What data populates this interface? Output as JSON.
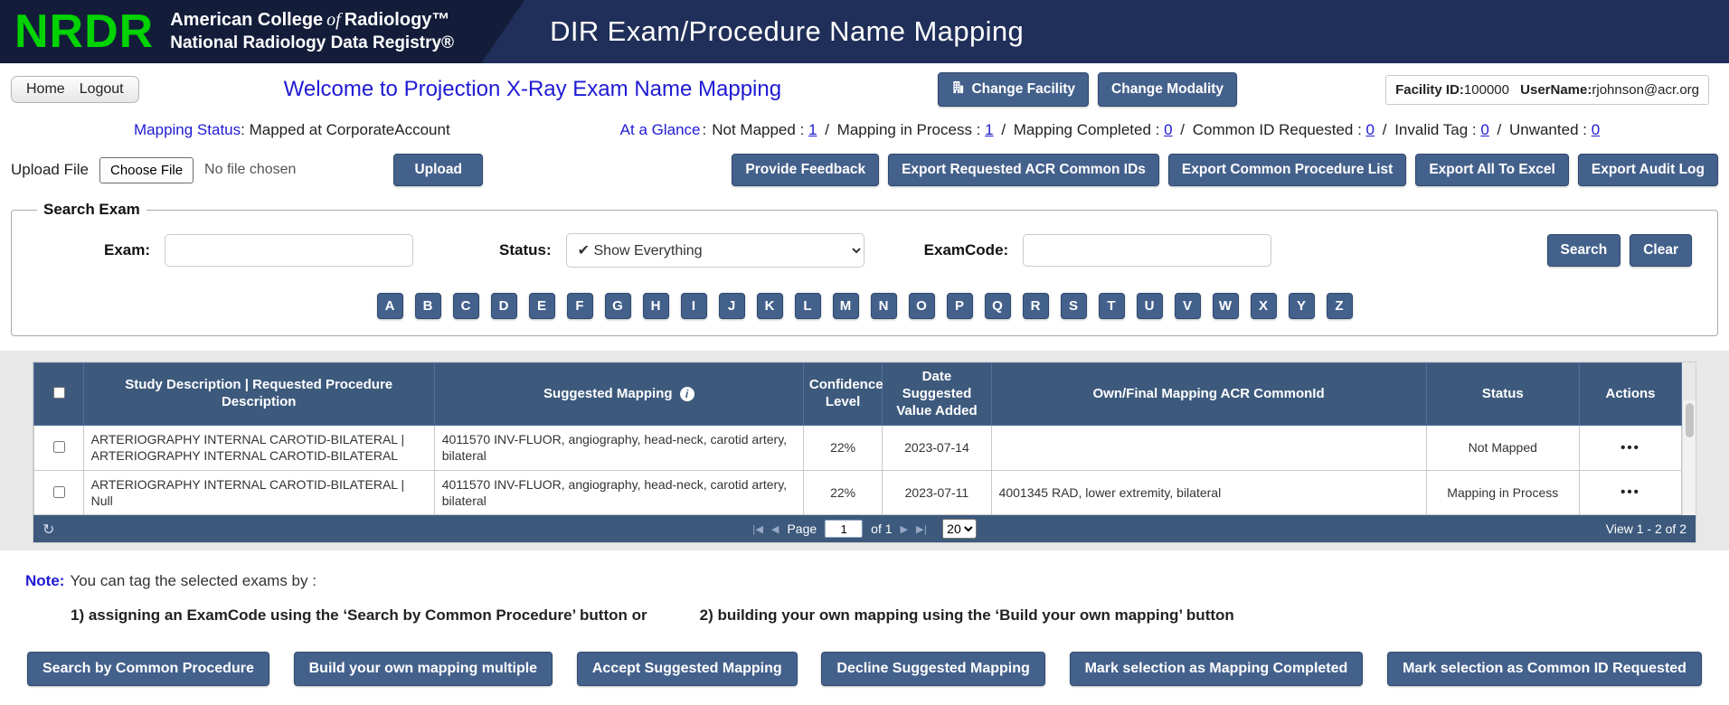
{
  "header": {
    "logo": "NRDR",
    "org_line1_pre": "American College",
    "org_line1_of": "of",
    "org_line1_post": "Radiology™",
    "org_line2": "National Radiology Data Registry®",
    "title": "DIR Exam/Procedure Name Mapping"
  },
  "topbar": {
    "home": "Home",
    "logout": "Logout",
    "welcome": "Welcome to Projection X-Ray Exam Name Mapping",
    "change_facility": "Change Facility",
    "change_modality": "Change Modality",
    "facility_id_label": "Facility ID:",
    "facility_id": "100000",
    "username_label": "UserName:",
    "username": "rjohnson@acr.org"
  },
  "status_row": {
    "mapping_status_label": "Mapping Status",
    "mapping_status_value": ": Mapped at CorporateAccount",
    "at_a_glance_label": "At a Glance",
    "at_a_glance_colon": ":",
    "separator": "/",
    "glance_items": [
      {
        "label": "Not Mapped",
        "count": "1"
      },
      {
        "label": "Mapping in Process",
        "count": "1"
      },
      {
        "label": "Mapping Completed",
        "count": "0"
      },
      {
        "label": "Common ID Requested",
        "count": "0"
      },
      {
        "label": "Invalid Tag",
        "count": "0"
      },
      {
        "label": "Unwanted",
        "count": "0"
      }
    ]
  },
  "upload_row": {
    "upload_file_label": "Upload File",
    "choose_file_label": "Choose File",
    "no_file_text": "No file chosen",
    "upload_button": "Upload",
    "export_buttons": [
      "Provide Feedback",
      "Export Requested ACR Common IDs",
      "Export Common Procedure List",
      "Export All To Excel",
      "Export Audit Log"
    ]
  },
  "search": {
    "legend": "Search Exam",
    "exam_label": "Exam:",
    "status_label": "Status:",
    "status_value": "✔ Show Everything",
    "examcode_label": "ExamCode:",
    "search_button": "Search",
    "clear_button": "Clear",
    "alphabet": [
      "A",
      "B",
      "C",
      "D",
      "E",
      "F",
      "G",
      "H",
      "I",
      "J",
      "K",
      "L",
      "M",
      "N",
      "O",
      "P",
      "Q",
      "R",
      "S",
      "T",
      "U",
      "V",
      "W",
      "X",
      "Y",
      "Z"
    ]
  },
  "table": {
    "columns": [
      {
        "key": "study_description",
        "label": "Study Description | Requested Procedure Description"
      },
      {
        "key": "suggested_mapping",
        "label": "Suggested Mapping",
        "info_icon": true
      },
      {
        "key": "confidence",
        "label": "Confidence Level"
      },
      {
        "key": "date_suggested",
        "label": "Date Suggested Value Added"
      },
      {
        "key": "own_final_mapping",
        "label": "Own/Final Mapping ACR CommonId"
      },
      {
        "key": "status",
        "label": "Status"
      },
      {
        "key": "actions",
        "label": "Actions"
      }
    ],
    "rows": [
      {
        "study_description": "ARTERIOGRAPHY INTERNAL CAROTID-BILATERAL | ARTERIOGRAPHY INTERNAL CAROTID-BILATERAL",
        "suggested_mapping": "4011570 INV-FLUOR, angiography, head-neck, carotid artery, bilateral",
        "confidence": "22%",
        "date_suggested": "2023-07-14",
        "own_final_mapping": "",
        "status": "Not Mapped",
        "actions": "•••"
      },
      {
        "study_description": "ARTERIOGRAPHY INTERNAL CAROTID-BILATERAL | Null",
        "suggested_mapping": "4011570 INV-FLUOR, angiography, head-neck, carotid artery, bilateral",
        "confidence": "22%",
        "date_suggested": "2023-07-11",
        "own_final_mapping": "4001345 RAD, lower extremity, bilateral",
        "status": "Mapping in Process",
        "actions": "•••"
      }
    ]
  },
  "pager": {
    "refresh_icon": "↻",
    "first_icon": "|◀",
    "prev_icon": "◀",
    "page_label": "Page",
    "page_value": "1",
    "of_label": "of 1",
    "next_icon": "▶",
    "last_icon": "▶|",
    "page_size": "20",
    "view_info": "View 1 - 2 of 2"
  },
  "note": {
    "note_label": "Note:",
    "note_text": "You can tag the selected exams by :",
    "instruction_1": "1) assigning an ExamCode using the ‘Search by Common Procedure’ button or",
    "instruction_2": "2) building your own mapping using the ‘Build your own mapping’ button"
  },
  "bottom_actions": [
    "Search by Common Procedure",
    "Build your own mapping multiple",
    "Accept Suggested Mapping",
    "Decline Suggested Mapping",
    "Mark selection as Mapping Completed",
    "Mark selection as Common ID Requested"
  ]
}
